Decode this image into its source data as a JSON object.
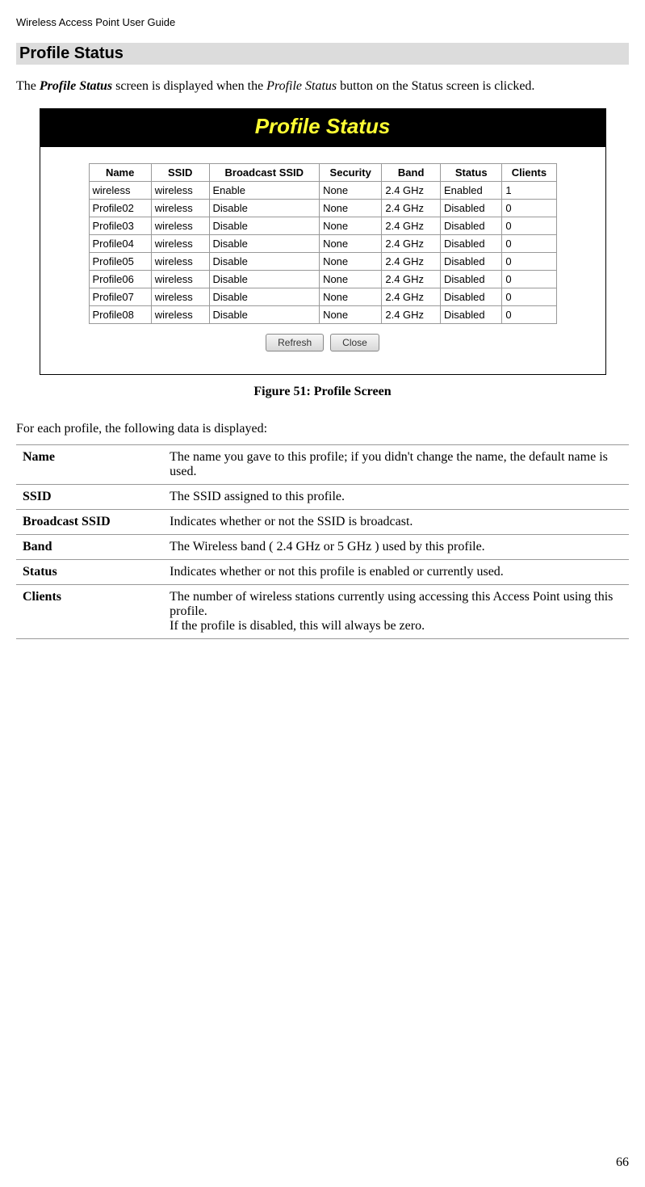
{
  "header": "Wireless Access Point User Guide",
  "section_title": "Profile Status",
  "intro": {
    "a": "The ",
    "b": "Profile Status",
    "c": " screen is displayed when the ",
    "d": "Profile Status",
    "e": " button on the Status screen is clicked."
  },
  "figure": {
    "titlebar": "Profile Status",
    "headers": [
      "Name",
      "SSID",
      "Broadcast SSID",
      "Security",
      "Band",
      "Status",
      "Clients"
    ],
    "rows": [
      {
        "name": "wireless",
        "ssid": "wireless",
        "broadcast": "Enable",
        "security": "None",
        "band": "2.4 GHz",
        "status": "Enabled",
        "clients": "1"
      },
      {
        "name": "Profile02",
        "ssid": "wireless",
        "broadcast": "Disable",
        "security": "None",
        "band": "2.4 GHz",
        "status": "Disabled",
        "clients": "0"
      },
      {
        "name": "Profile03",
        "ssid": "wireless",
        "broadcast": "Disable",
        "security": "None",
        "band": "2.4 GHz",
        "status": "Disabled",
        "clients": "0"
      },
      {
        "name": "Profile04",
        "ssid": "wireless",
        "broadcast": "Disable",
        "security": "None",
        "band": "2.4 GHz",
        "status": "Disabled",
        "clients": "0"
      },
      {
        "name": "Profile05",
        "ssid": "wireless",
        "broadcast": "Disable",
        "security": "None",
        "band": "2.4 GHz",
        "status": "Disabled",
        "clients": "0"
      },
      {
        "name": "Profile06",
        "ssid": "wireless",
        "broadcast": "Disable",
        "security": "None",
        "band": "2.4 GHz",
        "status": "Disabled",
        "clients": "0"
      },
      {
        "name": "Profile07",
        "ssid": "wireless",
        "broadcast": "Disable",
        "security": "None",
        "band": "2.4 GHz",
        "status": "Disabled",
        "clients": "0"
      },
      {
        "name": "Profile08",
        "ssid": "wireless",
        "broadcast": "Disable",
        "security": "None",
        "band": "2.4 GHz",
        "status": "Disabled",
        "clients": "0"
      }
    ],
    "buttons": {
      "refresh": "Refresh",
      "close": "Close"
    },
    "caption": "Figure 51: Profile Screen"
  },
  "lead": "For each profile, the following data is displayed:",
  "desc": [
    {
      "label": "Name",
      "text": "The name you gave to this profile; if you didn't change the name, the default name is used."
    },
    {
      "label": "SSID",
      "text": "The SSID assigned to this profile."
    },
    {
      "label": "Broadcast SSID",
      "text": "Indicates whether or not the SSID is broadcast."
    },
    {
      "label": "Band",
      "text": "The Wireless band ( 2.4 GHz or 5 GHz ) used by this profile."
    },
    {
      "label": "Status",
      "text": "Indicates whether or not this profile is enabled or currently used."
    },
    {
      "label": "Clients",
      "text": "The number of wireless stations currently using accessing this Access Point using this profile.\nIf the profile is disabled, this will always be zero."
    }
  ],
  "page_number": "66"
}
